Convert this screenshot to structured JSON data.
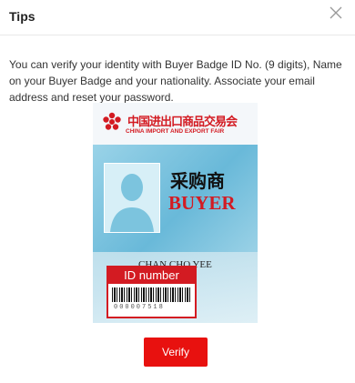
{
  "dialog": {
    "title": "Tips",
    "close_icon": "close-icon",
    "description": "You can verify your identity with Buyer Badge ID No. (9 digits), Name on your Buyer Badge and your nationality. Associate your email address and reset your password.",
    "verify_label": "Verify"
  },
  "badge": {
    "fair_name_cn": "中国进出口商品交易会",
    "fair_name_en": "CHINA IMPORT AND EXPORT FAIR",
    "role_cn": "采购商",
    "role_en": "BUYER",
    "holder_name": "CHAN CHO YEE",
    "id_label": "ID number",
    "id_digits": "000007518"
  },
  "colors": {
    "accent_red": "#e8110f",
    "badge_red": "#d31b22"
  }
}
